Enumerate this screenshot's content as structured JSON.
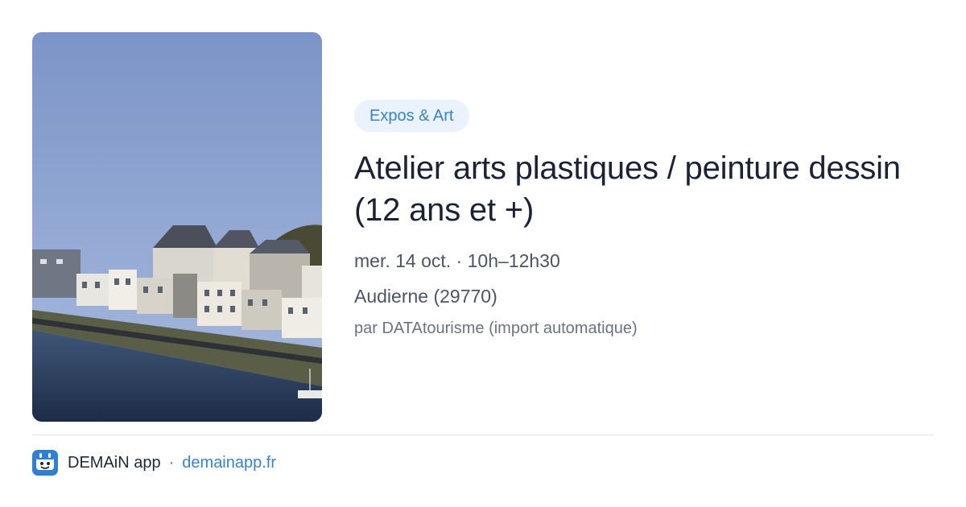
{
  "event": {
    "category": "Expos & Art",
    "title": "Atelier arts plastiques / peinture dessin (12 ans et +)",
    "datetime": "mer. 14 oct. · 10h–12h30",
    "location": "Audierne (29770)",
    "source": "par DATAtourisme (import automatique)"
  },
  "footer": {
    "app_name": "DEMAiN app",
    "separator": "·",
    "url": "demainapp.fr"
  },
  "colors": {
    "accent": "#3b82c4",
    "tag_background": "#eaf2fd",
    "title": "#1a2233",
    "meta": "#4b5563"
  }
}
